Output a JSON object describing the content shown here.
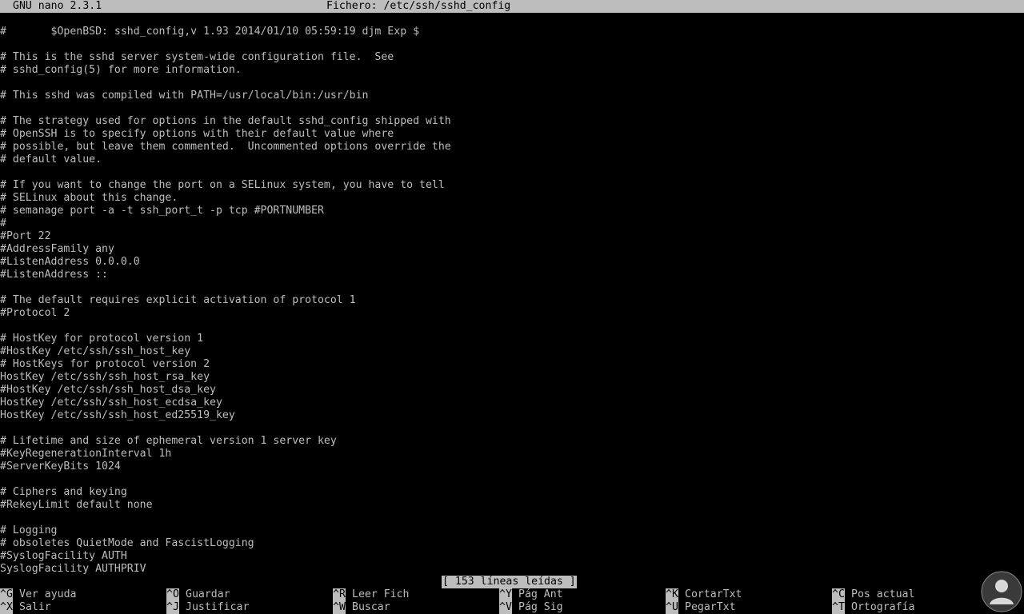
{
  "titlebar": {
    "app": "GNU nano 2.3.1",
    "file": "Fichero: /etc/ssh/sshd_config"
  },
  "editor": {
    "lines": [
      "#       $OpenBSD: sshd_config,v 1.93 2014/01/10 05:59:19 djm Exp $",
      "",
      "# This is the sshd server system-wide configuration file.  See",
      "# sshd_config(5) for more information.",
      "",
      "# This sshd was compiled with PATH=/usr/local/bin:/usr/bin",
      "",
      "# The strategy used for options in the default sshd_config shipped with",
      "# OpenSSH is to specify options with their default value where",
      "# possible, but leave them commented.  Uncommented options override the",
      "# default value.",
      "",
      "# If you want to change the port on a SELinux system, you have to tell",
      "# SELinux about this change.",
      "# semanage port -a -t ssh_port_t -p tcp #PORTNUMBER",
      "#",
      "#Port 22",
      "#AddressFamily any",
      "#ListenAddress 0.0.0.0",
      "#ListenAddress ::",
      "",
      "# The default requires explicit activation of protocol 1",
      "#Protocol 2",
      "",
      "# HostKey for protocol version 1",
      "#HostKey /etc/ssh/ssh_host_key",
      "# HostKeys for protocol version 2",
      "HostKey /etc/ssh/ssh_host_rsa_key",
      "#HostKey /etc/ssh/ssh_host_dsa_key",
      "HostKey /etc/ssh/ssh_host_ecdsa_key",
      "HostKey /etc/ssh/ssh_host_ed25519_key",
      "",
      "# Lifetime and size of ephemeral version 1 server key",
      "#KeyRegenerationInterval 1h",
      "#ServerKeyBits 1024",
      "",
      "# Ciphers and keying",
      "#RekeyLimit default none",
      "",
      "# Logging",
      "# obsoletes QuietMode and FascistLogging",
      "#SyslogFacility AUTH",
      "SyslogFacility AUTHPRIV"
    ]
  },
  "status": {
    "message": "[ 153 líneas leídas ]"
  },
  "shortcuts": {
    "row1": [
      {
        "key": "^G",
        "label": "Ver ayuda"
      },
      {
        "key": "^O",
        "label": "Guardar"
      },
      {
        "key": "^R",
        "label": "Leer Fich"
      },
      {
        "key": "^Y",
        "label": "Pág Ant"
      },
      {
        "key": "^K",
        "label": "CortarTxt"
      },
      {
        "key": "^C",
        "label": "Pos actual"
      }
    ],
    "row2": [
      {
        "key": "^X",
        "label": "Salir"
      },
      {
        "key": "^J",
        "label": "Justificar"
      },
      {
        "key": "^W",
        "label": "Buscar"
      },
      {
        "key": "^V",
        "label": "Pág Sig"
      },
      {
        "key": "^U",
        "label": "PegarTxt"
      },
      {
        "key": "^T",
        "label": "Ortografía"
      }
    ]
  },
  "colors": {
    "background": "#000000",
    "foreground": "#bdbdbd",
    "inverse_bg": "#bdbdbd",
    "inverse_fg": "#000000"
  },
  "watermark": {
    "icon": "user-silhouette-icon"
  }
}
